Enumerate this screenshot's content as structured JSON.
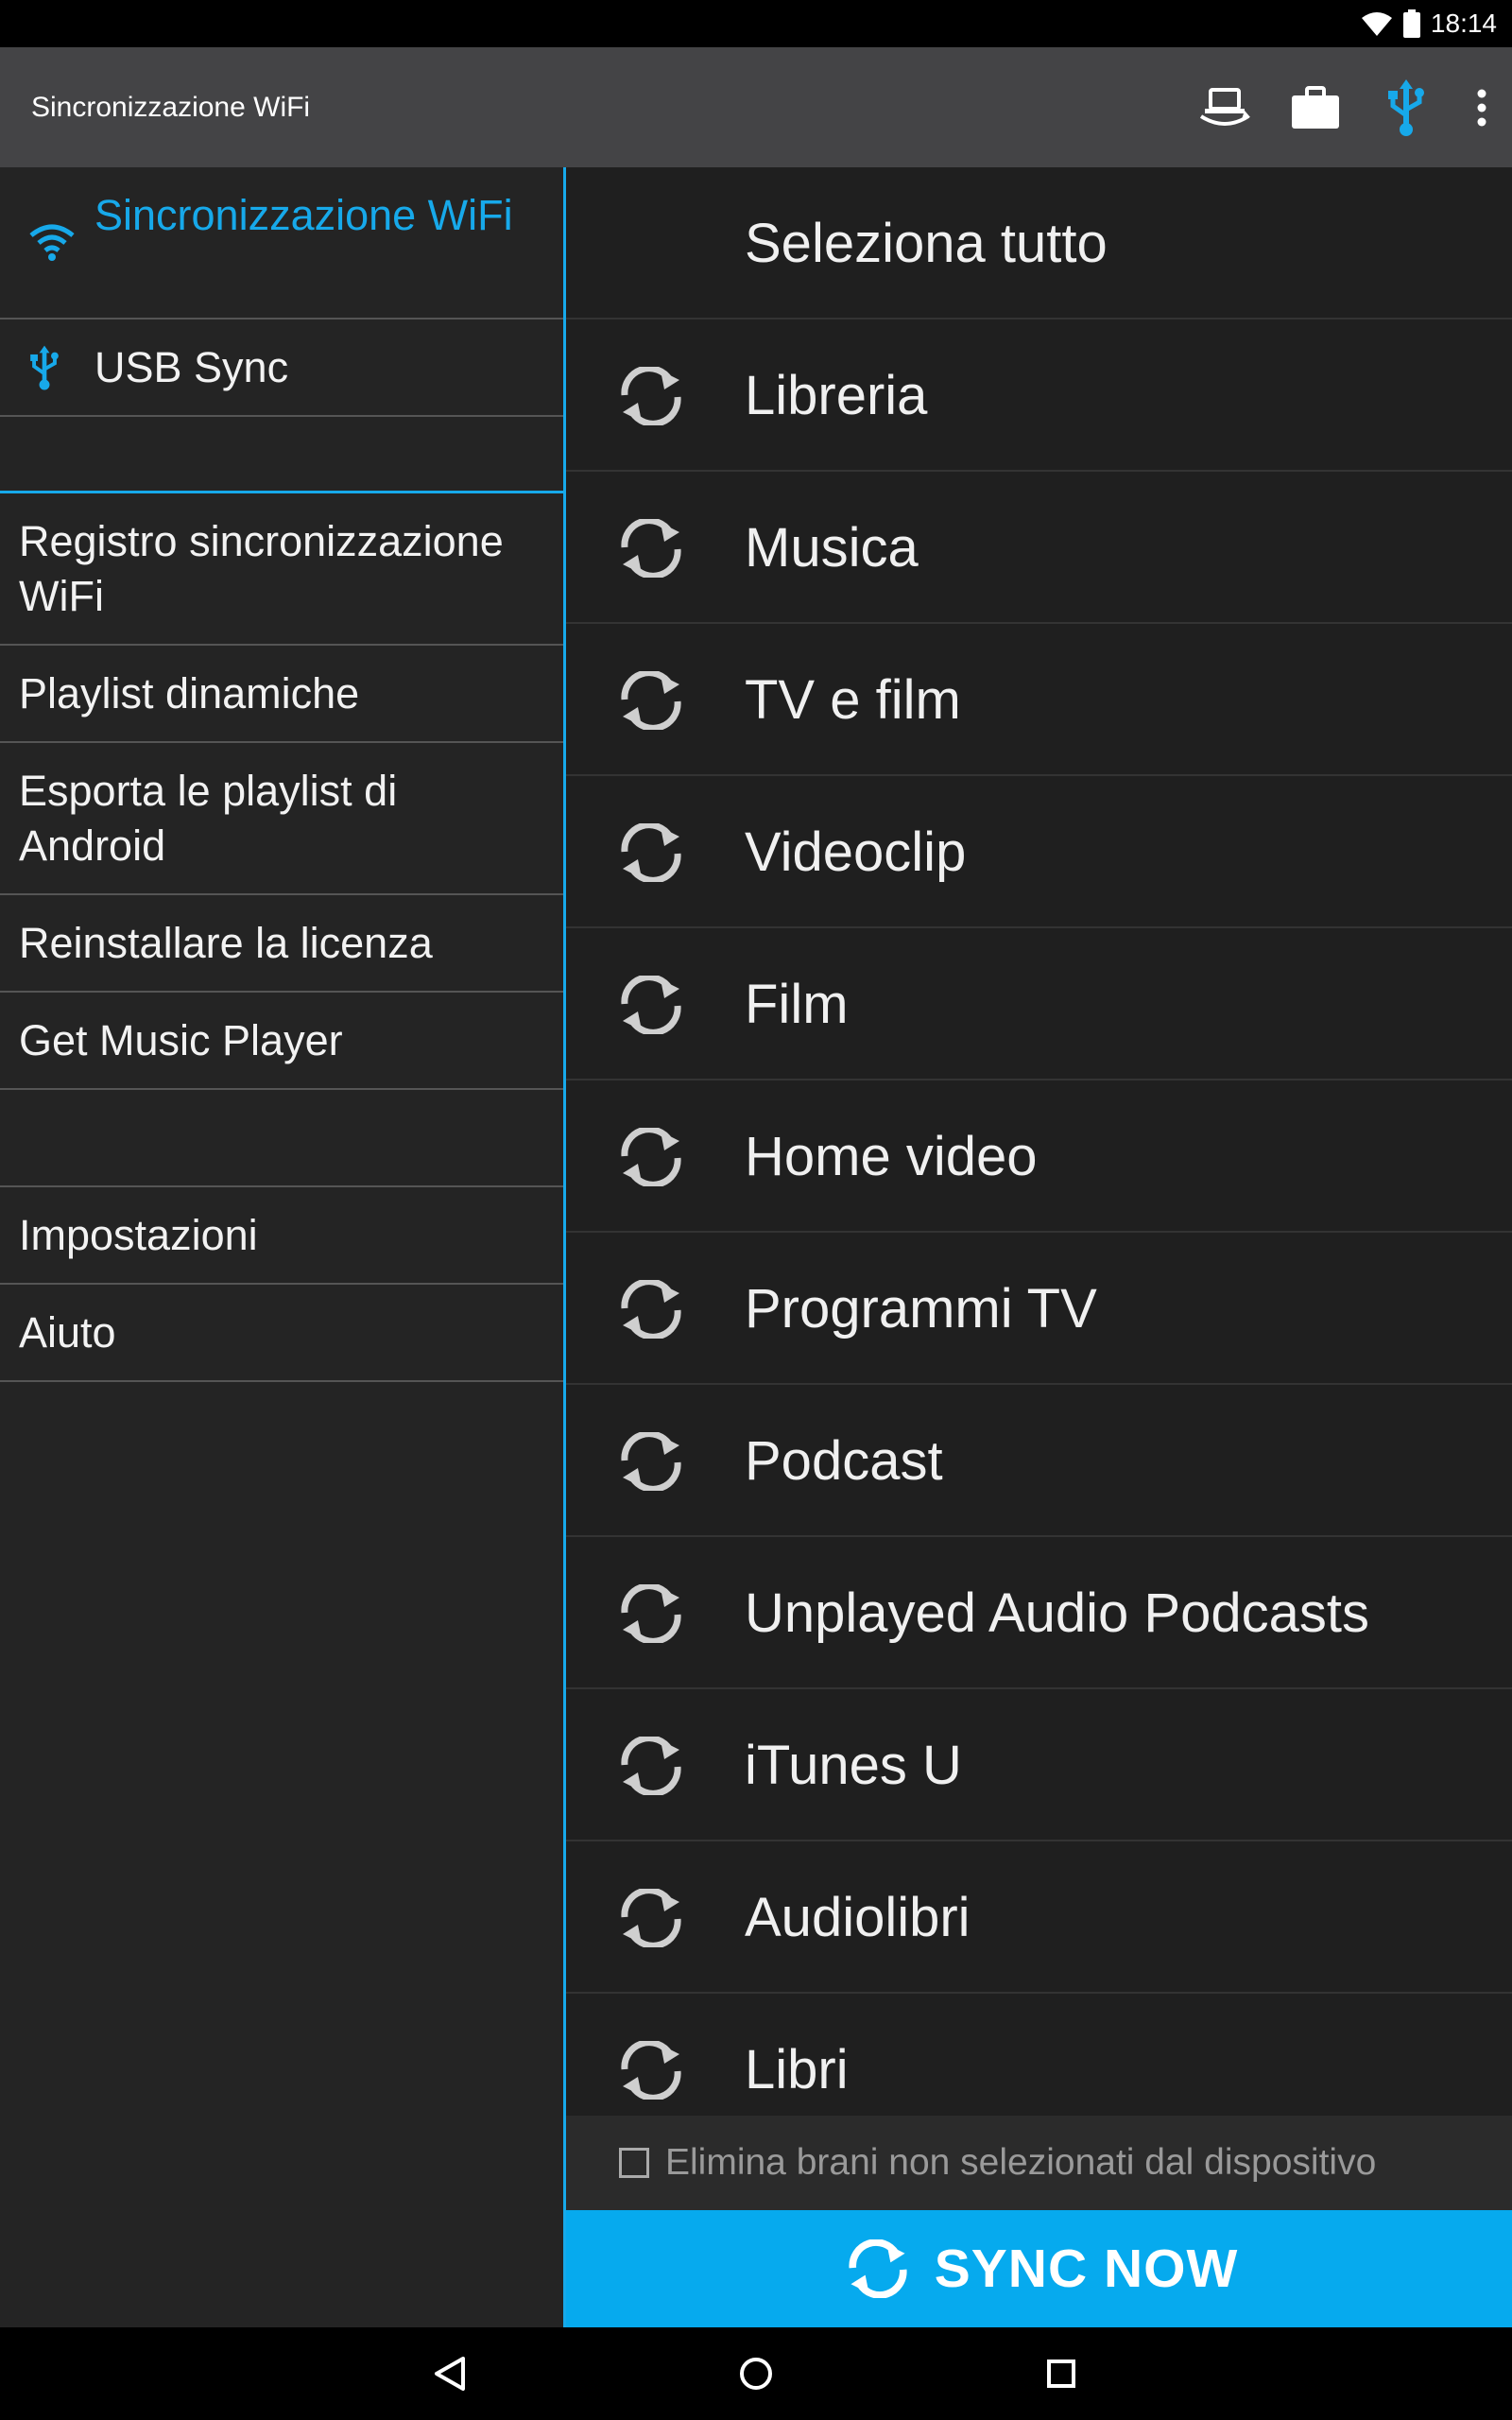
{
  "status_bar": {
    "time": "18:14",
    "icons": [
      "wifi-signal-icon",
      "battery-icon"
    ]
  },
  "app_bar": {
    "title": "Sincronizzazione WiFi",
    "actions": [
      "device-sync-icon",
      "briefcase-icon",
      "usb-icon",
      "overflow-menu-icon"
    ]
  },
  "sidebar": {
    "sync_modes": [
      {
        "label": "Sincronizzazione WiFi",
        "icon": "wifi-icon",
        "selected": true
      },
      {
        "label": "USB Sync",
        "icon": "usb-icon",
        "selected": false
      }
    ],
    "menu_items": [
      {
        "label": "Registro sincronizzazione WiFi"
      },
      {
        "label": "Playlist dinamiche"
      },
      {
        "label": "Esporta le playlist di Android"
      },
      {
        "label": "Reinstallare la licenza"
      },
      {
        "label": "Get Music Player"
      }
    ],
    "settings_items": [
      {
        "label": "Impostazioni"
      },
      {
        "label": "Aiuto"
      }
    ]
  },
  "content": {
    "select_all_label": "Seleziona tutto",
    "items": [
      {
        "label": "Libreria",
        "icon": "sync-icon"
      },
      {
        "label": "Musica",
        "icon": "sync-icon"
      },
      {
        "label": "TV e film",
        "icon": "sync-icon"
      },
      {
        "label": "Videoclip",
        "icon": "sync-icon"
      },
      {
        "label": "Film",
        "icon": "sync-icon"
      },
      {
        "label": "Home video",
        "icon": "sync-icon"
      },
      {
        "label": "Programmi TV",
        "icon": "sync-icon"
      },
      {
        "label": "Podcast",
        "icon": "sync-icon"
      },
      {
        "label": "Unplayed Audio Podcasts",
        "icon": "sync-icon"
      },
      {
        "label": "iTunes U",
        "icon": "sync-icon"
      },
      {
        "label": "Audiolibri",
        "icon": "sync-icon"
      },
      {
        "label": "Libri",
        "icon": "sync-icon"
      }
    ],
    "delete_option": {
      "label": "Elimina brani non selezionati dal dispositivo",
      "checked": false
    },
    "sync_button_label": "SYNC NOW"
  },
  "system_nav": [
    "back-icon",
    "home-icon",
    "recents-icon"
  ],
  "colors": {
    "accent": "#17a9ea",
    "sync_button": "#06aaee",
    "app_bar": "#444446",
    "sidebar_bg": "#242424",
    "content_bg": "#1f1f1f"
  }
}
